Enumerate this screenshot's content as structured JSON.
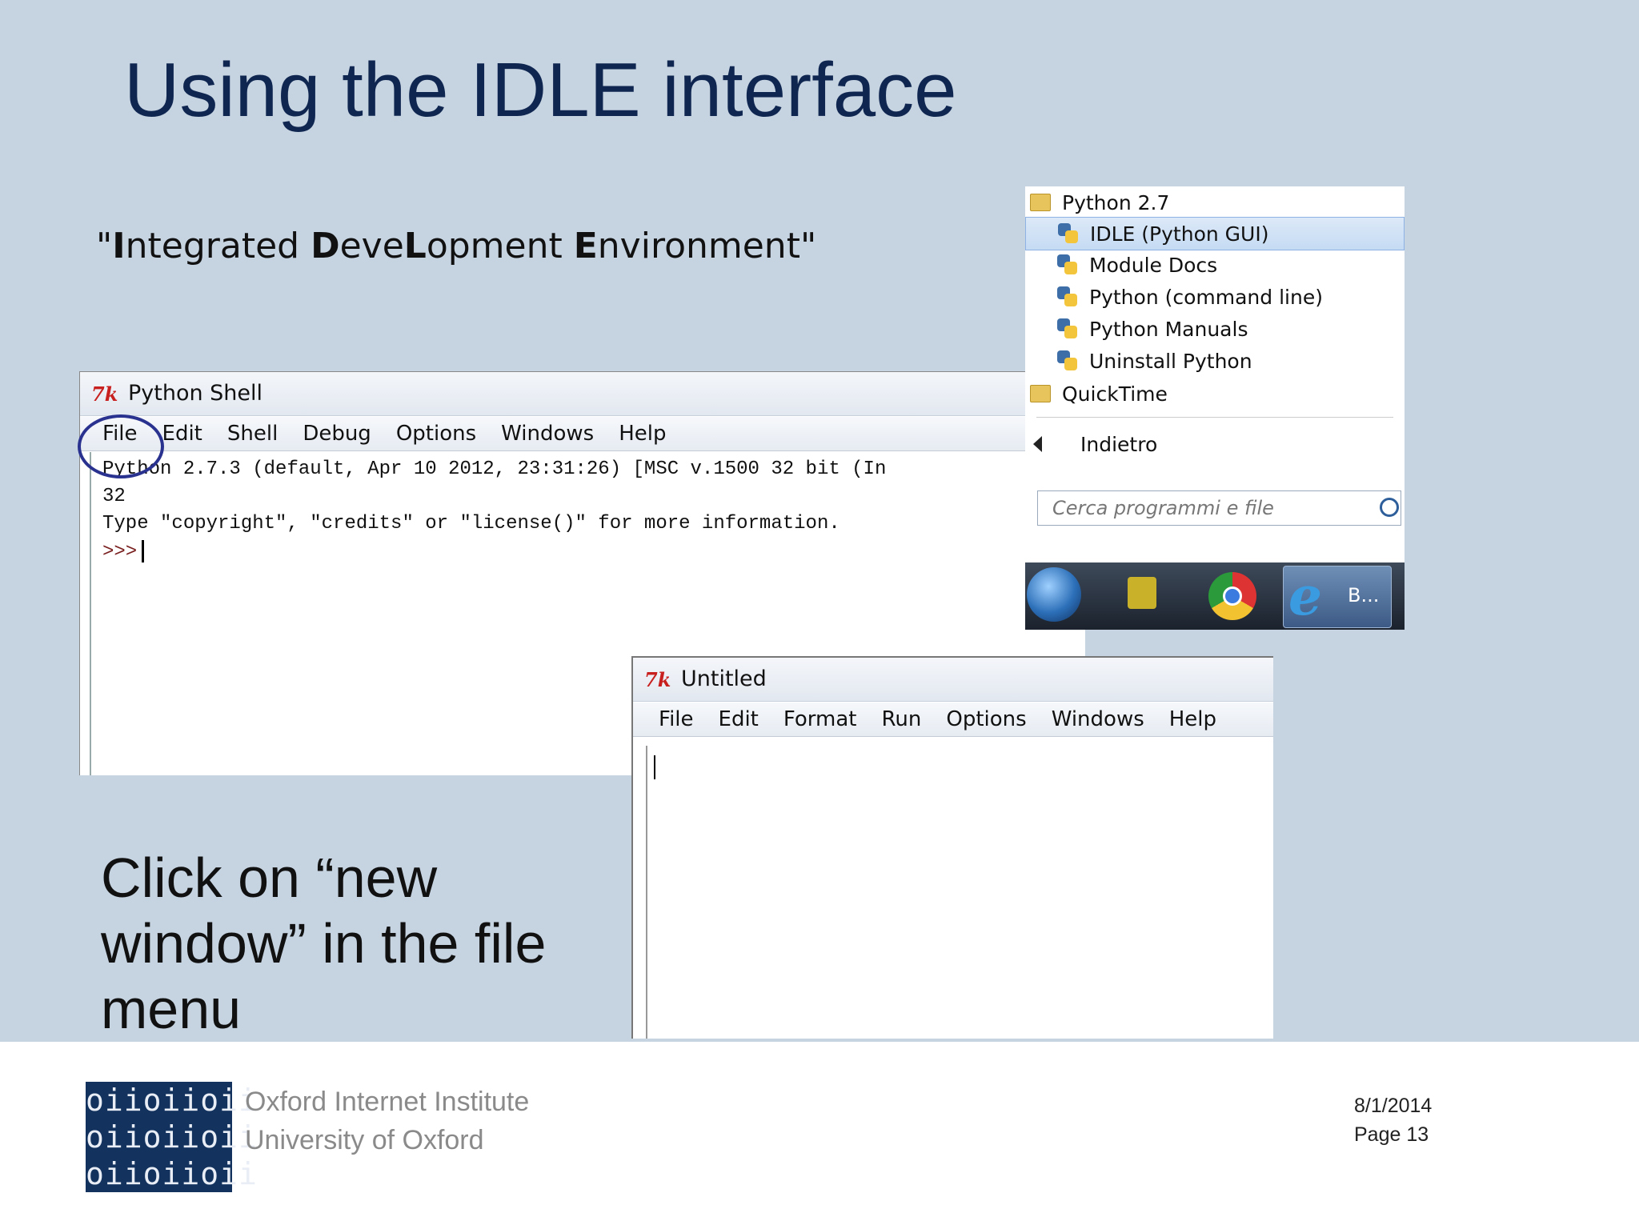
{
  "slide": {
    "title": "Using the IDLE interface",
    "subtitle_parts": [
      "\"",
      "I",
      "ntegrated ",
      "D",
      "eve",
      "L",
      "opment ",
      "E",
      "nvironment\""
    ],
    "instruction": "Click on “new window” in the file menu"
  },
  "shell_window": {
    "title": "Python Shell",
    "menu": [
      "File",
      "Edit",
      "Shell",
      "Debug",
      "Options",
      "Windows",
      "Help"
    ],
    "lines": [
      "Python 2.7.3 (default, Apr 10 2012, 23:31:26) [MSC v.1500 32 bit (In",
      "32",
      "Type \"copyright\", \"credits\" or \"license()\" for more information."
    ],
    "prompt": ">>>"
  },
  "editor_window": {
    "title": "Untitled",
    "menu": [
      "File",
      "Edit",
      "Format",
      "Run",
      "Options",
      "Windows",
      "Help"
    ]
  },
  "start_menu": {
    "folder": "Python 2.7",
    "items": [
      "IDLE (Python GUI)",
      "Module Docs",
      "Python (command line)",
      "Python Manuals",
      "Uninstall Python"
    ],
    "folder2": "QuickTime",
    "back": "Indietro",
    "search_placeholder": "Cerca programmi e file",
    "taskbar_label": "B..."
  },
  "footer": {
    "logo_rows": [
      "oiioiioii",
      "oiioiioii",
      "oiioiioii"
    ],
    "org_line1": "Oxford Internet Institute",
    "org_line2": "University of Oxford",
    "date": "8/1/2014",
    "page": "Page 13"
  },
  "colors": {
    "background": "#c6d3e1",
    "title": "#0f2650",
    "highlight_circle": "#2a3290"
  }
}
